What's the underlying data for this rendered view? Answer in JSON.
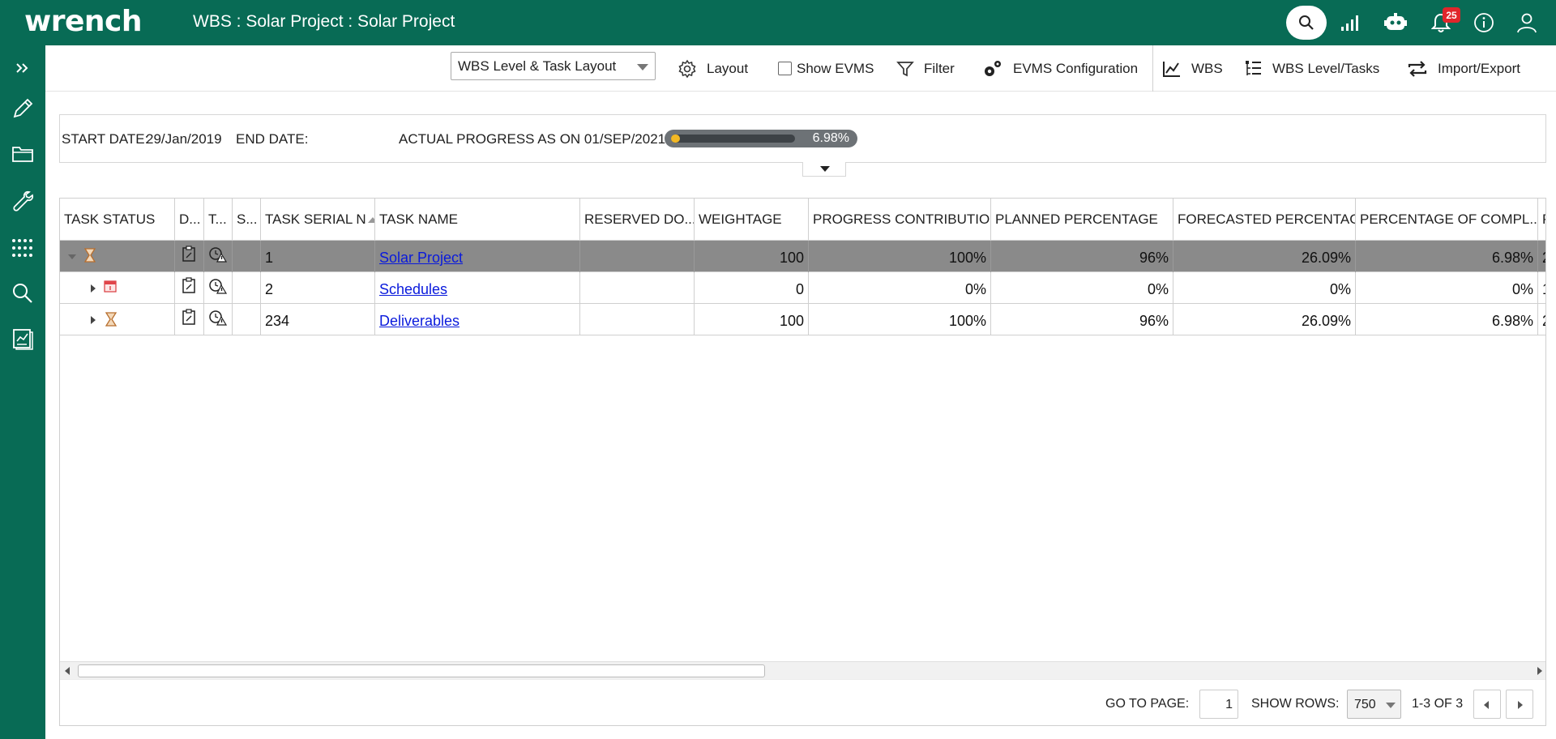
{
  "app": {
    "logo": "wrench",
    "breadcrumb": "WBS : Solar Project : Solar Project",
    "notification_count": "25"
  },
  "toolbar": {
    "layout_select": "WBS Level & Task Layout",
    "layout": "Layout",
    "show_evms": "Show EVMS",
    "filter": "Filter",
    "evms_configuration": "EVMS Configuration",
    "wbs": "WBS",
    "wbs_level_tasks": "WBS Level/Tasks",
    "import_export": "Import/Export"
  },
  "info": {
    "start_date_label": "START DATE:",
    "start_date": "29/Jan/2019",
    "end_date_label": "END DATE:",
    "actual_progress_label": "ACTUAL PROGRESS AS ON 01/SEP/2021:",
    "progress_text": "6.98%",
    "progress_value": 0.0698
  },
  "grid": {
    "headers": [
      "TASK STATUS",
      "D...",
      "T...",
      "S...",
      "TASK SERIAL N",
      "TASK NAME",
      "RESERVED DO...",
      "WEIGHTAGE",
      "PROGRESS CONTRIBUTIO...",
      "PLANNED PERCENTAGE",
      "FORECASTED PERCENTAGE",
      "PERCENTAGE OF COMPL...",
      "P"
    ],
    "rows": [
      {
        "serial": "1",
        "name": "Solar Project",
        "weightage": "100",
        "progress_contribution": "100%",
        "planned": "96%",
        "forecasted": "26.09%",
        "completion": "6.98%",
        "extra": "2"
      },
      {
        "serial": "2",
        "name": "Schedules",
        "weightage": "0",
        "progress_contribution": "0%",
        "planned": "0%",
        "forecasted": "0%",
        "completion": "0%",
        "extra": "1"
      },
      {
        "serial": "234",
        "name": "Deliverables",
        "weightage": "100",
        "progress_contribution": "100%",
        "planned": "96%",
        "forecasted": "26.09%",
        "completion": "6.98%",
        "extra": "2"
      }
    ]
  },
  "pager": {
    "go_to_page_label": "GO TO PAGE:",
    "page": "1",
    "show_rows_label": "SHOW ROWS:",
    "rows_per_page": "750",
    "range": "1-3 OF 3"
  },
  "colors": {
    "brand": "#086b55",
    "selected_row": "#8a8a8a",
    "link": "#0a1adc",
    "progress_fill": "#f2b824",
    "badge": "#e0262b"
  }
}
